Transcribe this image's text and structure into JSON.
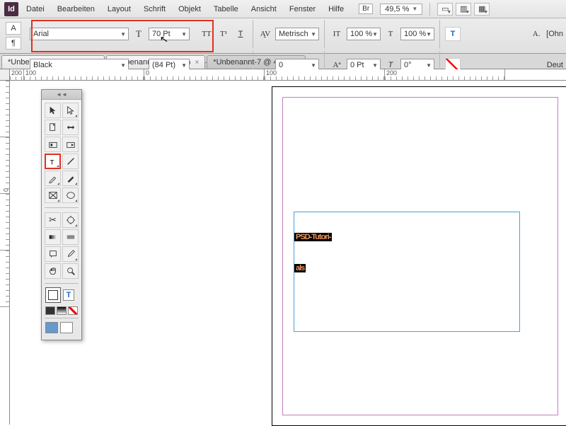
{
  "menu": {
    "items": [
      "Datei",
      "Bearbeiten",
      "Layout",
      "Schrift",
      "Objekt",
      "Tabelle",
      "Ansicht",
      "Fenster",
      "Hilfe"
    ],
    "br": "Br",
    "zoom": "49,5 %"
  },
  "ctrl": {
    "font": "Arial",
    "weight": "Black",
    "size": "70 Pt",
    "leading": "(84 Pt)",
    "kern_mode": "Metrisch",
    "tracking": "0",
    "hscale": "100 %",
    "vscale": "100 %",
    "baseline": "0 Pt",
    "skew": "0°",
    "lang": "Deut",
    "ohne": "[Ohn"
  },
  "tabs": [
    {
      "label": "*Unbenannt-3 @ 100 %",
      "active": false
    },
    {
      "label": "*Unbenannt-6 @ 50 %",
      "active": false
    },
    {
      "label": "*Unbenannt-7 @ 49 %",
      "active": true
    }
  ],
  "hruler": [
    "200",
    "100",
    "0",
    "100",
    "200"
  ],
  "vruler": [
    "",
    "0",
    "",
    "",
    ""
  ],
  "text": {
    "line1": "PSD-Tutori-",
    "line2": "als"
  }
}
